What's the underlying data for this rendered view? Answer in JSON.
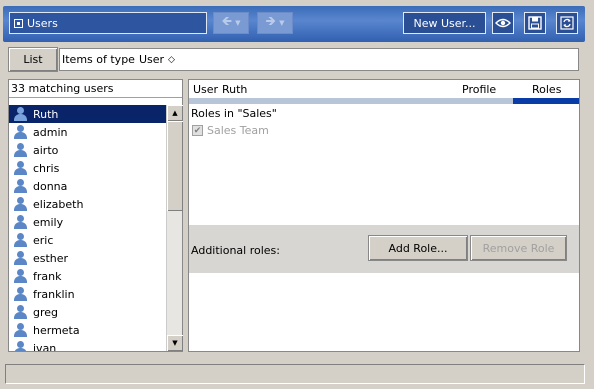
{
  "window": {
    "title": "Users",
    "new_user_label": "New User...",
    "back_icon": "arrow-left-icon",
    "forward_icon": "arrow-right-icon"
  },
  "toolbar": {
    "list_label": "List",
    "type_prefix": "Items of type",
    "type_value": "User",
    "type_dropdown_glyph": "◇"
  },
  "users_panel": {
    "match_count_text": "33 matching users",
    "users": [
      "Ruth",
      "admin",
      "airto",
      "chris",
      "donna",
      "elizabeth",
      "emily",
      "eric",
      "esther",
      "frank",
      "franklin",
      "greg",
      "hermeta",
      "ivan"
    ],
    "selected_user": "Ruth"
  },
  "detail": {
    "user_label": "User",
    "user_name": "Ruth",
    "tab_profile": "Profile",
    "tab_roles": "Roles",
    "roles_in_text": "Roles in \"Sales\"",
    "role_item": "Sales Team",
    "additional_roles_label": "Additional roles:",
    "add_role_label": "Add Role...",
    "remove_role_label": "Remove Role"
  },
  "colors": {
    "titlebar": "#3b6cb8",
    "selection": "#0a246a",
    "active_tab": "#0a3ca8"
  }
}
